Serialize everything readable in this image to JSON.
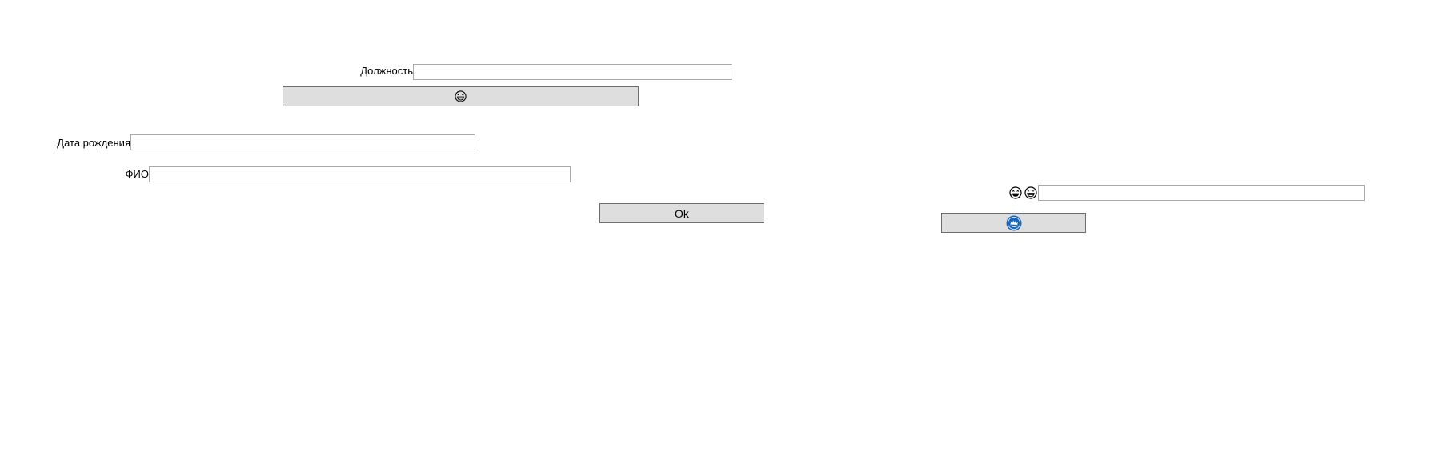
{
  "form": {
    "position_label": "Должность",
    "position_value": "",
    "birthdate_label": "Дата рождения",
    "birthdate_value": "",
    "fullname_label": "ФИО",
    "fullname_value": "",
    "ok_label": "Ok",
    "emoji_button_icon": "grinning-face-icon",
    "right_field_value": "",
    "right_icons": [
      "laughing-face-icon",
      "grinning-face-icon"
    ],
    "blue_button_icon": "blue-round-badge-icon"
  },
  "colors": {
    "button_bg": "#dedede",
    "button_border": "#6e6e6e",
    "field_border": "#a9a9a9",
    "badge_blue": "#1565c0"
  }
}
